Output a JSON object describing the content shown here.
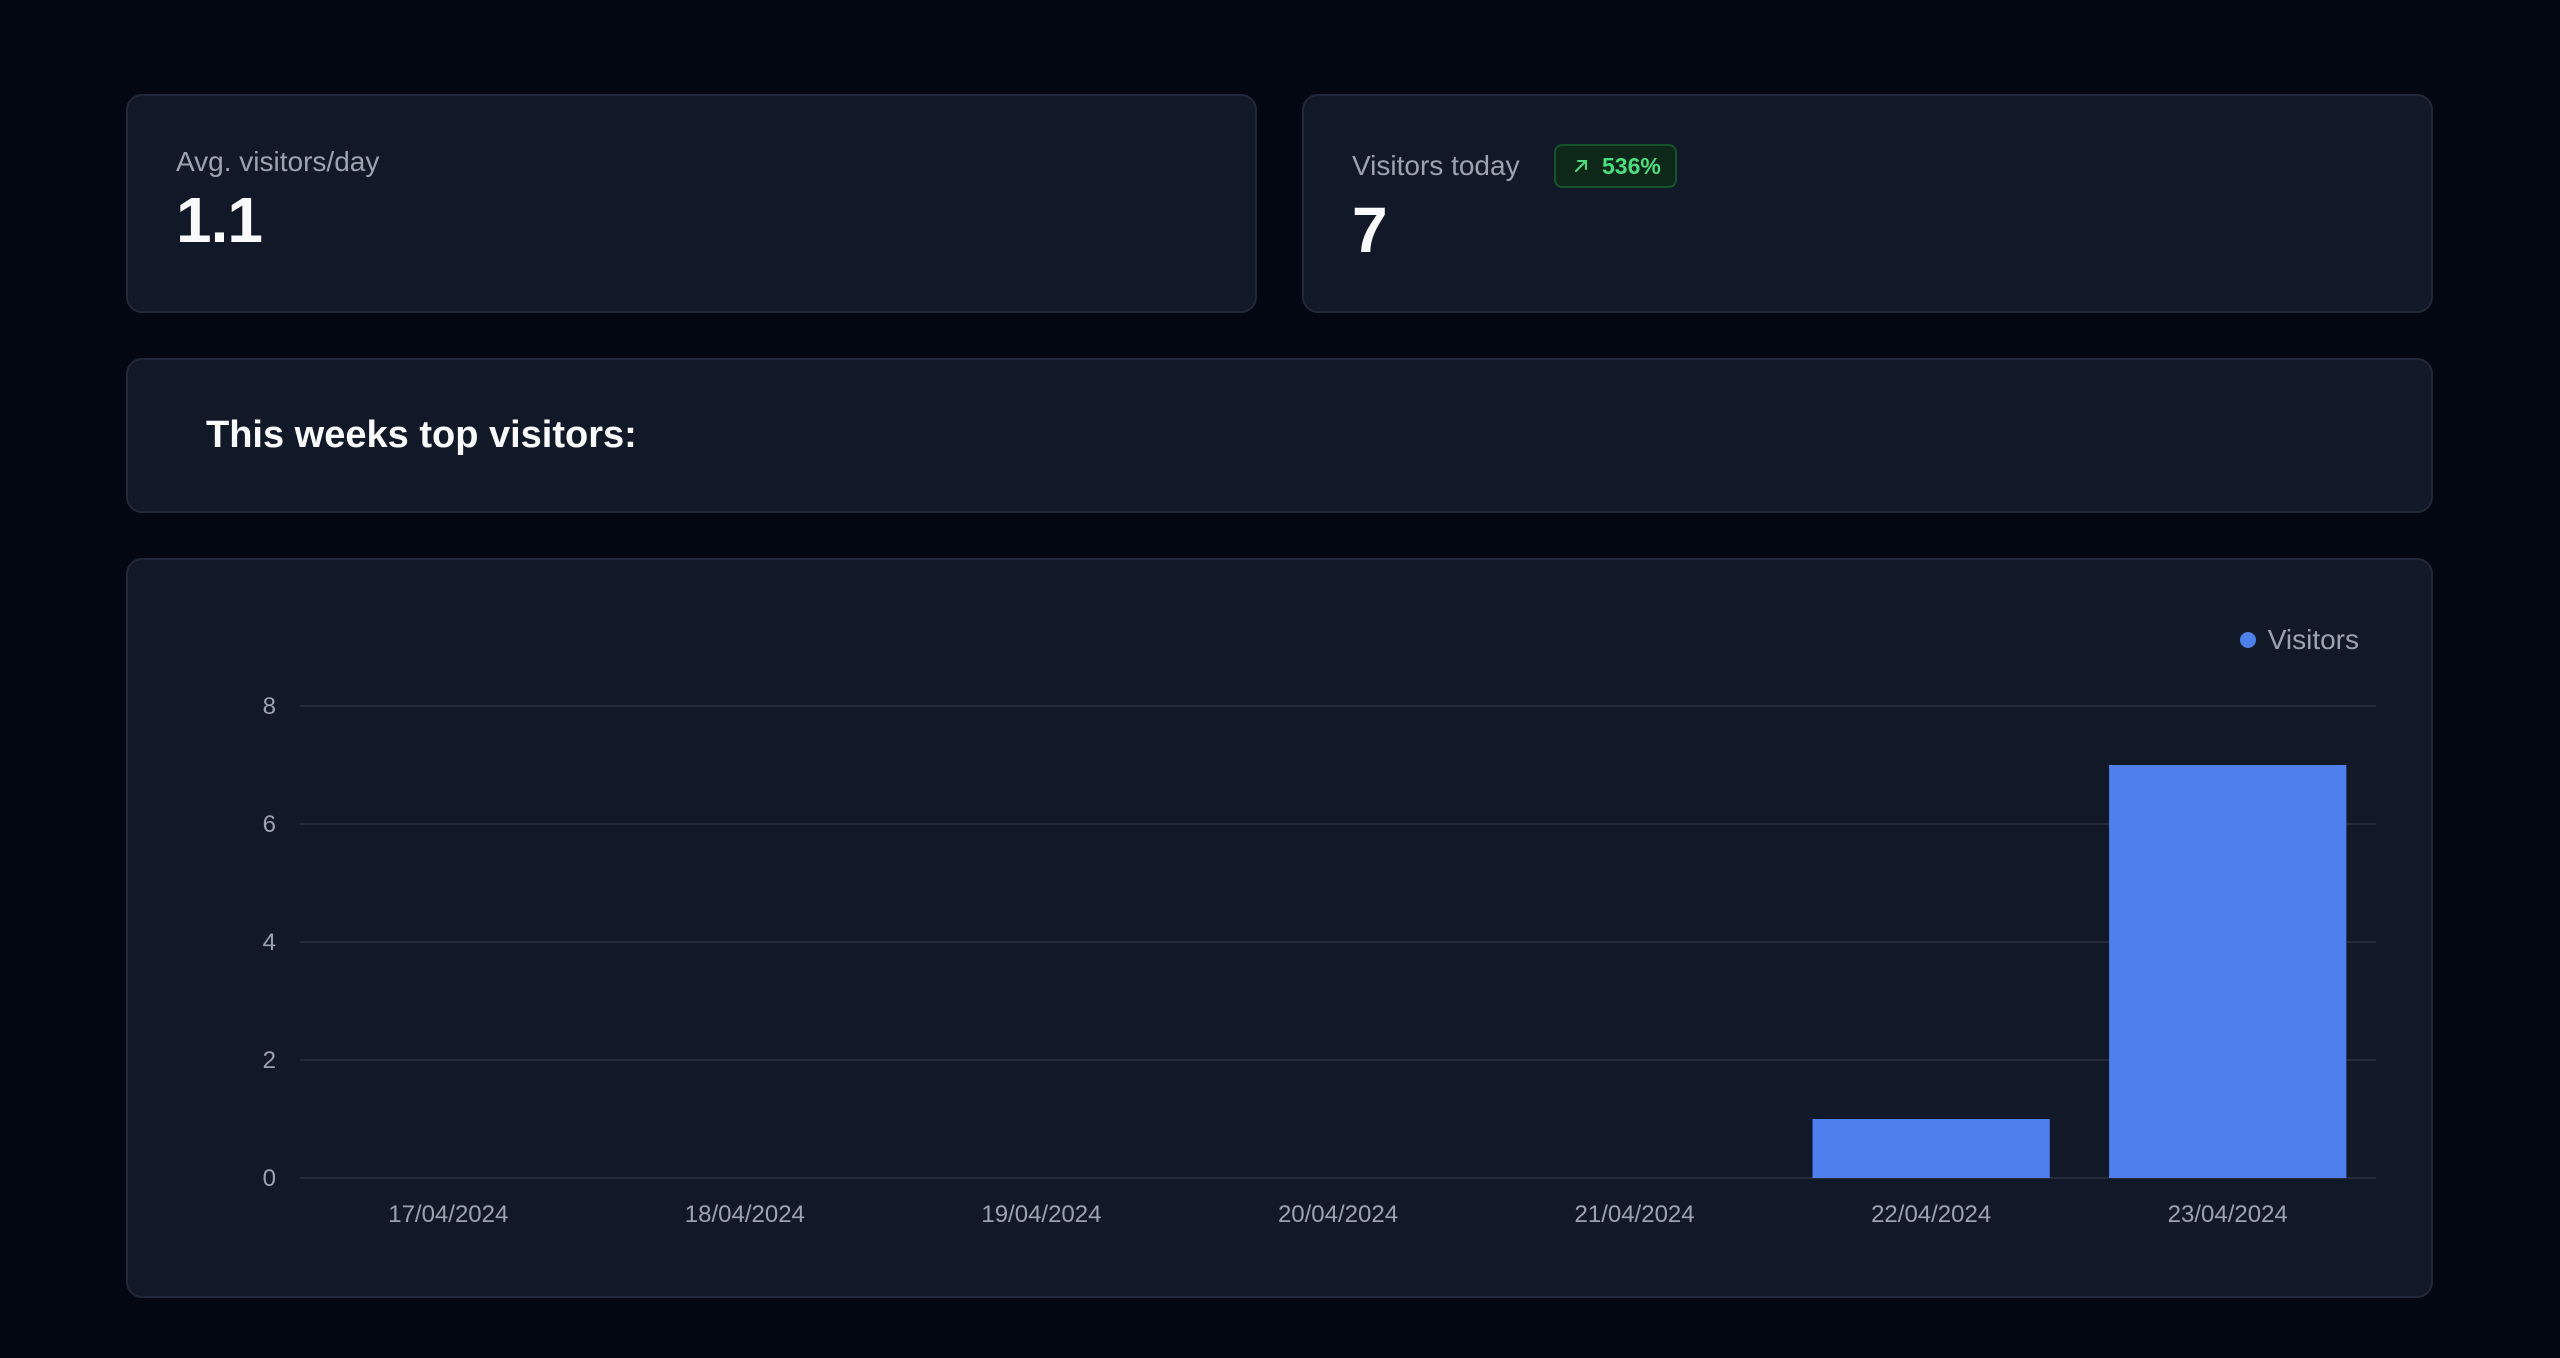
{
  "stats": {
    "avg_label": "Avg. visitors/day",
    "avg_value": "1.1",
    "today_label": "Visitors today",
    "today_value": "7",
    "today_change": "536%"
  },
  "top_visitors": {
    "title": "This weeks top visitors:"
  },
  "colors": {
    "bar": "#4f7fec",
    "badge_text": "#4ade80",
    "grid": "#2a3140"
  },
  "icons": {
    "badge": "arrow-up-right-icon",
    "legend": "legend-dot-icon"
  },
  "chart_data": {
    "type": "bar",
    "categories": [
      "17/04/2024",
      "18/04/2024",
      "19/04/2024",
      "20/04/2024",
      "21/04/2024",
      "22/04/2024",
      "23/04/2024"
    ],
    "series": [
      {
        "name": "Visitors",
        "values": [
          0,
          0,
          0,
          0,
          0,
          1,
          7
        ]
      }
    ],
    "yticks": [
      0,
      2,
      4,
      6,
      8
    ],
    "ylim": [
      0,
      8
    ],
    "grid": true,
    "legend": "top-right",
    "title": "",
    "xlabel": "",
    "ylabel": ""
  }
}
